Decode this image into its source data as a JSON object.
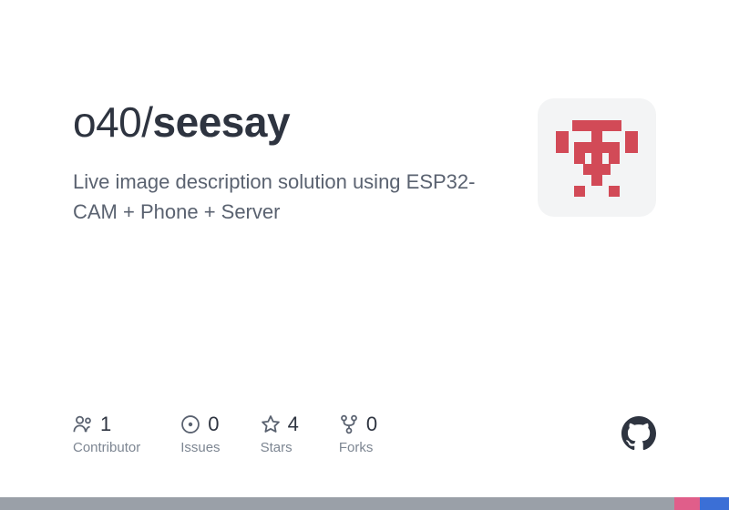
{
  "owner": "o40",
  "separator": "/",
  "repo": "seesay",
  "description": "Live image description solution using ESP32-CAM + Phone + Server",
  "stats": {
    "contributors": {
      "count": "1",
      "label": "Contributor"
    },
    "issues": {
      "count": "0",
      "label": "Issues"
    },
    "stars": {
      "count": "4",
      "label": "Stars"
    },
    "forks": {
      "count": "0",
      "label": "Forks"
    }
  },
  "colors": {
    "bar_gray": "#9aa0a8",
    "bar_pink": "#e05e8a",
    "bar_blue": "#3b6fd6",
    "avatar_red": "#d24a57"
  }
}
